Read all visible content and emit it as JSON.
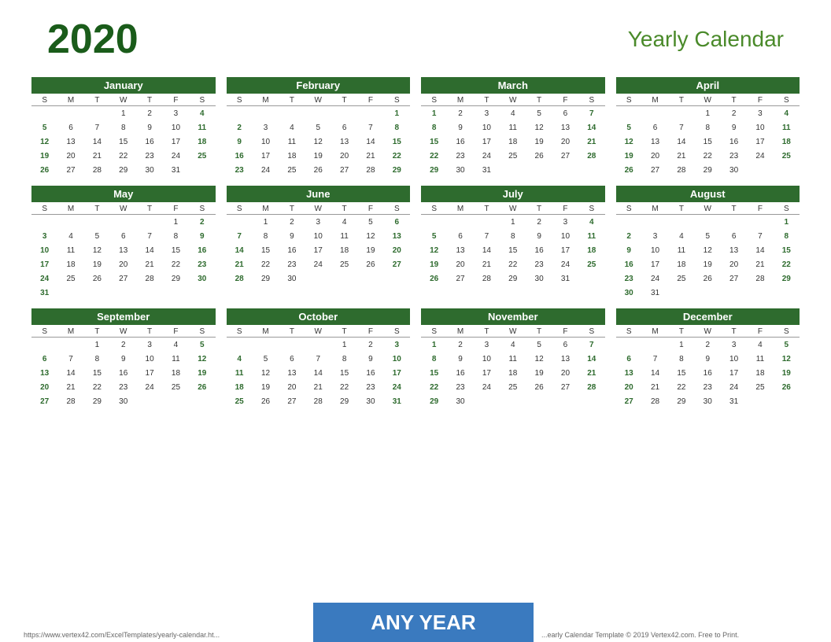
{
  "header": {
    "year": "2020",
    "title": "Yearly Calendar"
  },
  "footer": {
    "url": "https://www.vertex42.com/ExcelTemplates/yearly-calendar.ht...",
    "banner": "ANY YEAR",
    "copyright": "...early Calendar Template © 2019 Vertex42.com. Free to Print."
  },
  "days_header": [
    "S",
    "M",
    "T",
    "W",
    "T",
    "F",
    "S"
  ],
  "months": [
    {
      "name": "January",
      "weeks": [
        [
          "",
          "",
          "",
          "1",
          "2",
          "3",
          "4"
        ],
        [
          "5",
          "6",
          "7",
          "8",
          "9",
          "10",
          "11"
        ],
        [
          "12",
          "13",
          "14",
          "15",
          "16",
          "17",
          "18"
        ],
        [
          "19",
          "20",
          "21",
          "22",
          "23",
          "24",
          "25"
        ],
        [
          "26",
          "27",
          "28",
          "29",
          "30",
          "31",
          ""
        ]
      ]
    },
    {
      "name": "February",
      "weeks": [
        [
          "",
          "",
          "",
          "",
          "",
          "",
          "1"
        ],
        [
          "2",
          "3",
          "4",
          "5",
          "6",
          "7",
          "8"
        ],
        [
          "9",
          "10",
          "11",
          "12",
          "13",
          "14",
          "15"
        ],
        [
          "16",
          "17",
          "18",
          "19",
          "20",
          "21",
          "22"
        ],
        [
          "23",
          "24",
          "25",
          "26",
          "27",
          "28",
          "29"
        ]
      ]
    },
    {
      "name": "March",
      "weeks": [
        [
          "1",
          "2",
          "3",
          "4",
          "5",
          "6",
          "7"
        ],
        [
          "8",
          "9",
          "10",
          "11",
          "12",
          "13",
          "14"
        ],
        [
          "15",
          "16",
          "17",
          "18",
          "19",
          "20",
          "21"
        ],
        [
          "22",
          "23",
          "24",
          "25",
          "26",
          "27",
          "28"
        ],
        [
          "29",
          "30",
          "31",
          "",
          "",
          "",
          ""
        ]
      ]
    },
    {
      "name": "April",
      "weeks": [
        [
          "",
          "",
          "",
          "1",
          "2",
          "3",
          "4"
        ],
        [
          "5",
          "6",
          "7",
          "8",
          "9",
          "10",
          "11"
        ],
        [
          "12",
          "13",
          "14",
          "15",
          "16",
          "17",
          "18"
        ],
        [
          "19",
          "20",
          "21",
          "22",
          "23",
          "24",
          "25"
        ],
        [
          "26",
          "27",
          "28",
          "29",
          "30",
          "",
          ""
        ]
      ]
    },
    {
      "name": "May",
      "weeks": [
        [
          "",
          "",
          "",
          "",
          "",
          "1",
          "2"
        ],
        [
          "3",
          "4",
          "5",
          "6",
          "7",
          "8",
          "9"
        ],
        [
          "10",
          "11",
          "12",
          "13",
          "14",
          "15",
          "16"
        ],
        [
          "17",
          "18",
          "19",
          "20",
          "21",
          "22",
          "23"
        ],
        [
          "24",
          "25",
          "26",
          "27",
          "28",
          "29",
          "30"
        ],
        [
          "31",
          "",
          "",
          "",
          "",
          "",
          ""
        ]
      ]
    },
    {
      "name": "June",
      "weeks": [
        [
          "",
          "1",
          "2",
          "3",
          "4",
          "5",
          "6"
        ],
        [
          "7",
          "8",
          "9",
          "10",
          "11",
          "12",
          "13"
        ],
        [
          "14",
          "15",
          "16",
          "17",
          "18",
          "19",
          "20"
        ],
        [
          "21",
          "22",
          "23",
          "24",
          "25",
          "26",
          "27"
        ],
        [
          "28",
          "29",
          "30",
          "",
          "",
          "",
          ""
        ]
      ]
    },
    {
      "name": "July",
      "weeks": [
        [
          "",
          "",
          "",
          "1",
          "2",
          "3",
          "4"
        ],
        [
          "5",
          "6",
          "7",
          "8",
          "9",
          "10",
          "11"
        ],
        [
          "12",
          "13",
          "14",
          "15",
          "16",
          "17",
          "18"
        ],
        [
          "19",
          "20",
          "21",
          "22",
          "23",
          "24",
          "25"
        ],
        [
          "26",
          "27",
          "28",
          "29",
          "30",
          "31",
          ""
        ]
      ]
    },
    {
      "name": "August",
      "weeks": [
        [
          "",
          "",
          "",
          "",
          "",
          "",
          "1"
        ],
        [
          "2",
          "3",
          "4",
          "5",
          "6",
          "7",
          "8"
        ],
        [
          "9",
          "10",
          "11",
          "12",
          "13",
          "14",
          "15"
        ],
        [
          "16",
          "17",
          "18",
          "19",
          "20",
          "21",
          "22"
        ],
        [
          "23",
          "24",
          "25",
          "26",
          "27",
          "28",
          "29"
        ],
        [
          "30",
          "31",
          "",
          "",
          "",
          "",
          ""
        ]
      ]
    },
    {
      "name": "September",
      "weeks": [
        [
          "",
          "",
          "1",
          "2",
          "3",
          "4",
          "5"
        ],
        [
          "6",
          "7",
          "8",
          "9",
          "10",
          "11",
          "12"
        ],
        [
          "13",
          "14",
          "15",
          "16",
          "17",
          "18",
          "19"
        ],
        [
          "20",
          "21",
          "22",
          "23",
          "24",
          "25",
          "26"
        ],
        [
          "27",
          "28",
          "29",
          "30",
          "",
          "",
          ""
        ]
      ]
    },
    {
      "name": "October",
      "weeks": [
        [
          "",
          "",
          "",
          "",
          "1",
          "2",
          "3"
        ],
        [
          "4",
          "5",
          "6",
          "7",
          "8",
          "9",
          "10"
        ],
        [
          "11",
          "12",
          "13",
          "14",
          "15",
          "16",
          "17"
        ],
        [
          "18",
          "19",
          "20",
          "21",
          "22",
          "23",
          "24"
        ],
        [
          "25",
          "26",
          "27",
          "28",
          "29",
          "30",
          "31"
        ]
      ]
    },
    {
      "name": "November",
      "weeks": [
        [
          "1",
          "2",
          "3",
          "4",
          "5",
          "6",
          "7"
        ],
        [
          "8",
          "9",
          "10",
          "11",
          "12",
          "13",
          "14"
        ],
        [
          "15",
          "16",
          "17",
          "18",
          "19",
          "20",
          "21"
        ],
        [
          "22",
          "23",
          "24",
          "25",
          "26",
          "27",
          "28"
        ],
        [
          "29",
          "30",
          "",
          "",
          "",
          "",
          ""
        ]
      ]
    },
    {
      "name": "December",
      "weeks": [
        [
          "",
          "",
          "1",
          "2",
          "3",
          "4",
          "5"
        ],
        [
          "6",
          "7",
          "8",
          "9",
          "10",
          "11",
          "12"
        ],
        [
          "13",
          "14",
          "15",
          "16",
          "17",
          "18",
          "19"
        ],
        [
          "20",
          "21",
          "22",
          "23",
          "24",
          "25",
          "26"
        ],
        [
          "27",
          "28",
          "29",
          "30",
          "31",
          "",
          ""
        ]
      ]
    }
  ]
}
